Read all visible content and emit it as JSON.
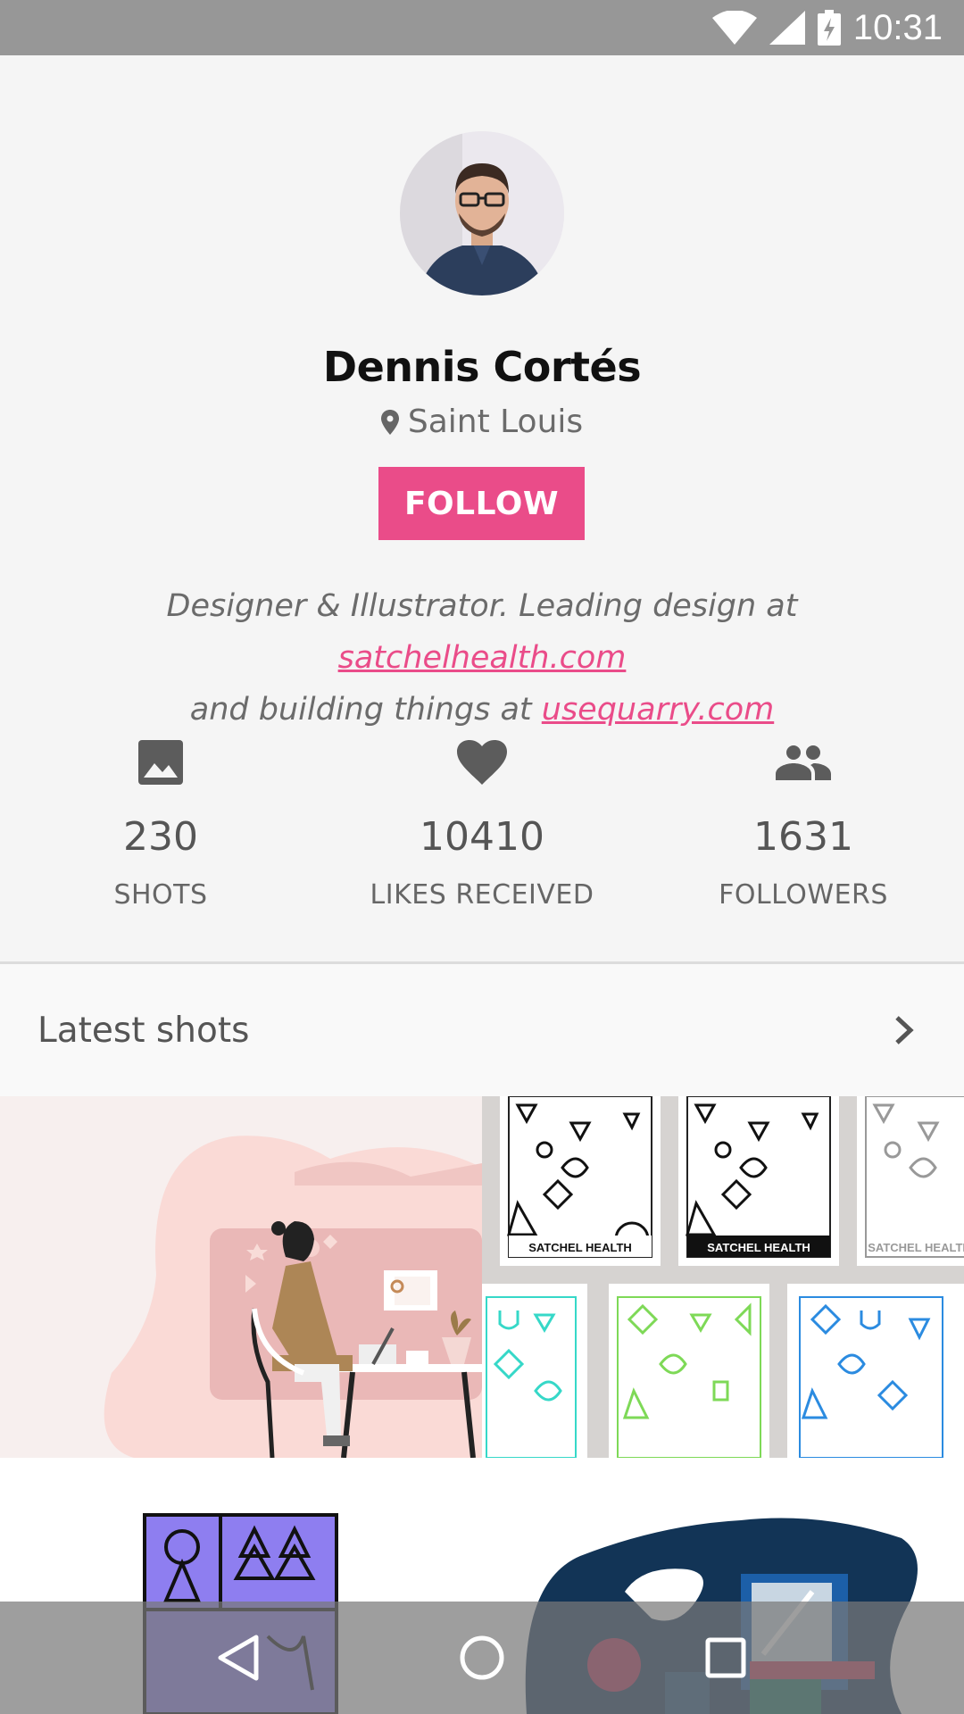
{
  "status_bar": {
    "time": "10:31",
    "icons": [
      "wifi-icon",
      "signal-icon",
      "battery-charging-icon"
    ]
  },
  "profile": {
    "name": "Dennis Cortés",
    "location": "Saint Louis",
    "follow_label": "FOLLOW",
    "bio": {
      "part1": "Designer & Illustrator. Leading design at ",
      "link1": "satchelhealth.com",
      "part2": " and building things at ",
      "link2": "usequarry.com"
    }
  },
  "stats": [
    {
      "icon": "image-icon",
      "value": "230",
      "label": "SHOTS"
    },
    {
      "icon": "heart-icon",
      "value": "10410",
      "label": "LIKES RECEIVED"
    },
    {
      "icon": "people-icon",
      "value": "1631",
      "label": "FOLLOWERS"
    }
  ],
  "latest_shots": {
    "title": "Latest shots"
  },
  "shots": [
    {
      "name": "illustration-woman-at-desk"
    },
    {
      "name": "satchel-health-pattern-cards",
      "card_text": "SATCHEL HEALTH"
    },
    {
      "name": "purple-forest-illustration"
    },
    {
      "name": "dark-blue-blob-illustration"
    }
  ],
  "colors": {
    "accent": "#ea4c89",
    "status_bar": "#979797"
  },
  "nav_bar": {
    "icons": [
      "back-icon",
      "home-icon",
      "recents-icon"
    ]
  }
}
